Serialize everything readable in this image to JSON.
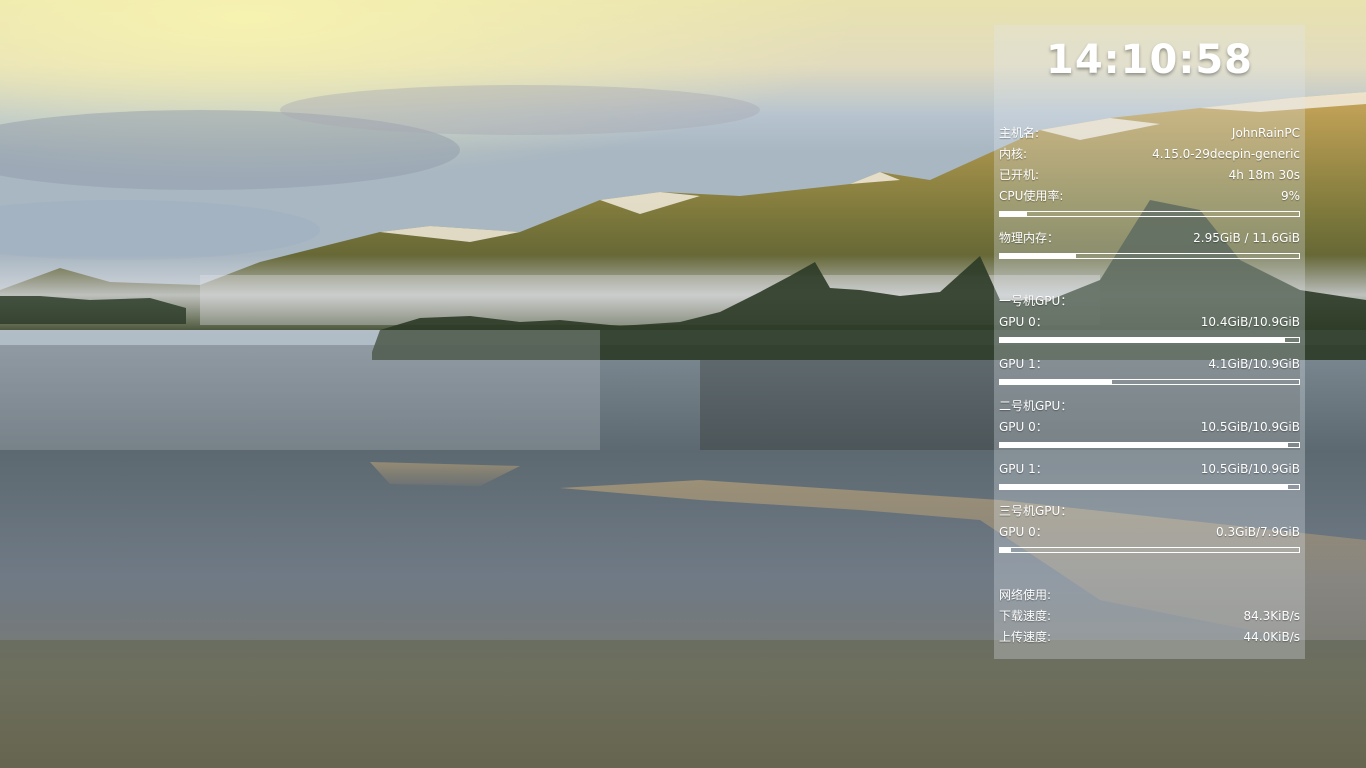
{
  "clock": "14:10:58",
  "system": {
    "hostname_label": "主机名:",
    "hostname": "JohnRainPC",
    "kernel_label": "内核:",
    "kernel": "4.15.0-29deepin-generic",
    "uptime_label": "已开机:",
    "uptime": "4h 18m 30s",
    "cpu_label": "CPU使用率:",
    "cpu": "9%",
    "cpu_fraction": 0.09,
    "mem_label": "物理内存：",
    "mem": "2.95GiB / 11.6GiB",
    "mem_fraction": 0.254
  },
  "machines": [
    {
      "title": "一号机GPU：",
      "gpus": [
        {
          "label": "GPU 0：",
          "value": "10.4GiB/10.9GiB",
          "fraction": 0.954
        },
        {
          "label": "GPU 1：",
          "value": "4.1GiB/10.9GiB",
          "fraction": 0.376
        }
      ]
    },
    {
      "title": "二号机GPU：",
      "gpus": [
        {
          "label": "GPU 0：",
          "value": "10.5GiB/10.9GiB",
          "fraction": 0.963
        },
        {
          "label": "GPU 1：",
          "value": "10.5GiB/10.9GiB",
          "fraction": 0.963
        }
      ]
    },
    {
      "title": "三号机GPU：",
      "gpus": [
        {
          "label": "GPU 0：",
          "value": "0.3GiB/7.9GiB",
          "fraction": 0.038
        }
      ]
    }
  ],
  "network": {
    "title": "网络使用:",
    "download_label": "下载速度:",
    "download": "84.3KiB/s",
    "upload_label": "上传速度:",
    "upload": "44.0KiB/s"
  }
}
